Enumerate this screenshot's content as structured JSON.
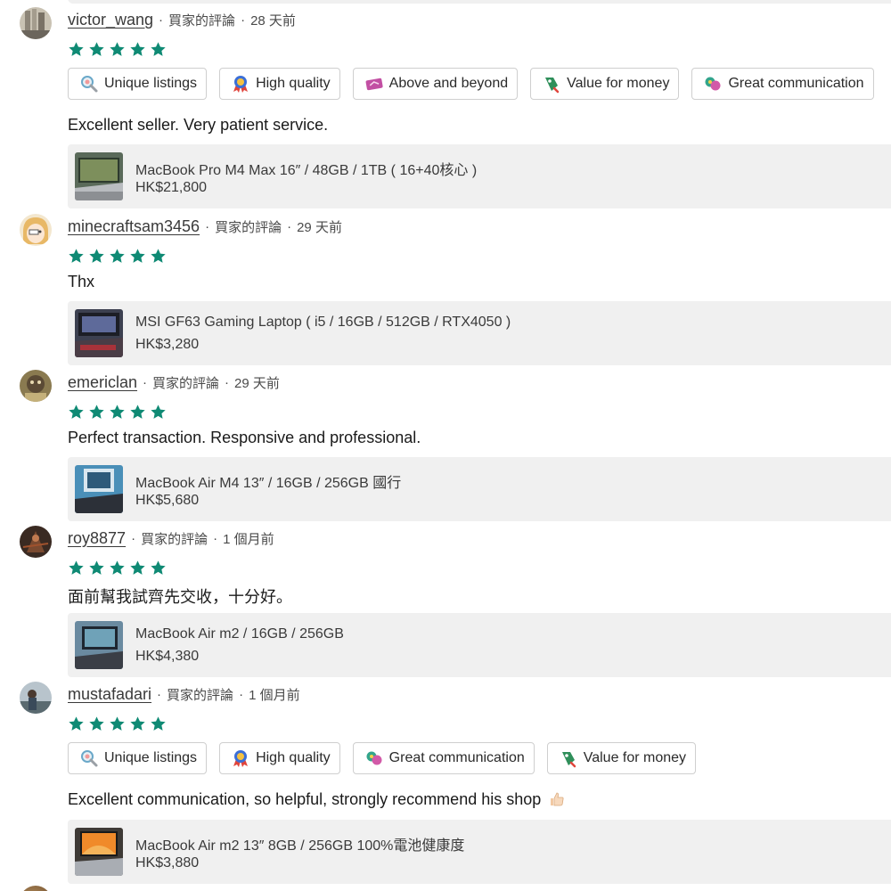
{
  "colors": {
    "star": "#0f8a74",
    "product_bg": "#f0f0f0",
    "tag_border": "#cfcfcf"
  },
  "reviews": [
    {
      "username": "victor_wang",
      "meta": "買家的評論",
      "time": "28 天前",
      "rating": 5,
      "tags": [
        "Unique listings",
        "High quality",
        "Above and beyond",
        "Value for money",
        "Great communication"
      ],
      "comment": "Excellent seller. Very patient service.",
      "product": {
        "title": "MacBook Pro M4 Max 16″ / 48GB / 1TB ( 16+40核心 )",
        "price": "HK$21,800"
      }
    },
    {
      "username": "minecraftsam3456",
      "meta": "買家的評論",
      "time": "29 天前",
      "rating": 5,
      "tags": [],
      "comment": "Thx",
      "product": {
        "title": "MSI GF63 Gaming Laptop ( i5 / 16GB / 512GB / RTX4050 )",
        "price": "HK$3,280"
      }
    },
    {
      "username": "emericlan",
      "meta": "買家的評論",
      "time": "29 天前",
      "rating": 5,
      "tags": [],
      "comment": "Perfect transaction. Responsive and professional.",
      "product": {
        "title": "MacBook Air M4 13″ / 16GB / 256GB 國行",
        "price": "HK$5,680"
      }
    },
    {
      "username": "roy8877",
      "meta": "買家的評論",
      "time": "1 個月前",
      "rating": 5,
      "tags": [],
      "comment": "面前幫我試齊先交收，十分好。",
      "product": {
        "title": "MacBook Air m2 / 16GB / 256GB",
        "price": "HK$4,380"
      }
    },
    {
      "username": "mustafadari",
      "meta": "買家的評論",
      "time": "1 個月前",
      "rating": 5,
      "tags": [
        "Unique listings",
        "High quality",
        "Great communication",
        "Value for money"
      ],
      "comment": "Excellent communication, so helpful, strongly recommend his shop",
      "product": {
        "title": "MacBook Air m2 13″ 8GB / 256GB 100%電池健康度",
        "price": "HK$3,880"
      }
    }
  ]
}
